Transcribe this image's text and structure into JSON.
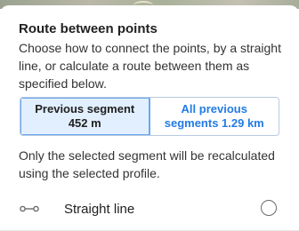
{
  "dialog": {
    "title": "Route between points",
    "description": "Choose how to connect the points, by a straight line, or calculate a route between them as specified below.",
    "segments": [
      {
        "label": "Previous segment 452 m",
        "selected": true
      },
      {
        "label": "All previous segments 1.29 km",
        "selected": false
      }
    ],
    "note": "Only the selected segment will be recalculated using the selected profile.",
    "options": [
      {
        "label": "Straight line",
        "icon": "straight-line-icon",
        "checked": false
      }
    ]
  },
  "colors": {
    "accent": "#237be6",
    "selected_bg": "#e1efff",
    "text": "#212121"
  }
}
